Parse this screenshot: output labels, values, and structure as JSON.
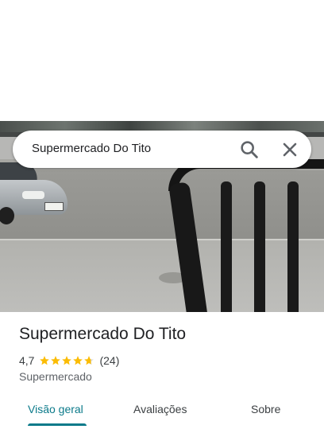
{
  "search": {
    "query": "Supermercado Do Tito",
    "search_icon": "search-icon",
    "close_icon": "close-icon"
  },
  "place": {
    "name": "Supermercado Do Tito",
    "rating": "4,7",
    "stars": 4.7,
    "review_count": "(24)",
    "category": "Supermercado"
  },
  "tabs": [
    {
      "label": "Visão geral",
      "active": true
    },
    {
      "label": "Avaliações",
      "active": false
    },
    {
      "label": "Sobre",
      "active": false
    }
  ],
  "colors": {
    "accent": "#0b7a8a",
    "star": "#fbbc04"
  }
}
